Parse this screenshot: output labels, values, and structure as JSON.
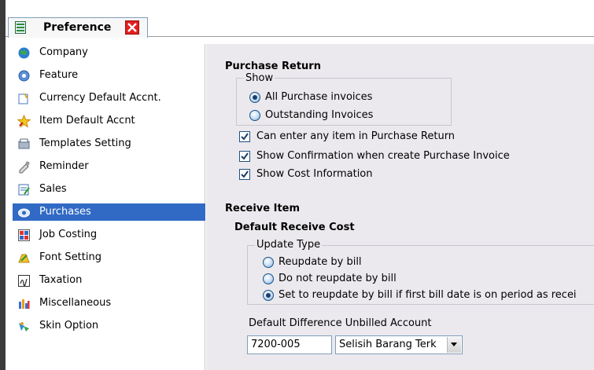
{
  "tab": {
    "label": "Preference"
  },
  "sidebar": {
    "items": [
      {
        "label": "Company",
        "icon": "globe-icon"
      },
      {
        "label": "Feature",
        "icon": "gear-icon"
      },
      {
        "label": "Currency Default Accnt.",
        "icon": "currency-icon"
      },
      {
        "label": "Item Default Accnt",
        "icon": "star-icon"
      },
      {
        "label": "Templates Setting",
        "icon": "templates-icon"
      },
      {
        "label": "Reminder",
        "icon": "reminder-icon"
      },
      {
        "label": "Sales",
        "icon": "sales-icon"
      },
      {
        "label": "Purchases",
        "icon": "purchases-icon",
        "selected": true
      },
      {
        "label": "Job Costing",
        "icon": "job-costing-icon"
      },
      {
        "label": "Font Setting",
        "icon": "font-icon"
      },
      {
        "label": "Taxation",
        "icon": "taxation-icon"
      },
      {
        "label": "Miscellaneous",
        "icon": "miscellaneous-icon"
      },
      {
        "label": "Skin Option",
        "icon": "skin-icon"
      }
    ]
  },
  "purchase_return": {
    "title": "Purchase Return",
    "show_legend": "Show",
    "options": [
      "All Purchase invoices",
      "Outstanding Invoices"
    ],
    "selected_option": "All Purchase invoices",
    "checkboxes": [
      {
        "label": "Can enter any item in Purchase Return",
        "checked": true
      },
      {
        "label": "Show Confirmation when create Purchase Invoice",
        "checked": true
      },
      {
        "label": "Show Cost Information",
        "checked": true
      }
    ]
  },
  "receive_item": {
    "title": "Receive Item",
    "subtitle": "Default Receive Cost",
    "update_legend": "Update Type",
    "options": [
      "Reupdate by bill",
      "Do not reupdate by bill",
      "Set to reupdate by bill if first bill date is on period as recei"
    ],
    "selected_option": "Set to reupdate by bill if first bill date is on period as recei",
    "account_label": "Default Difference Unbilled Account",
    "account_code": "7200-005",
    "account_name": "Selisih Barang Terk"
  },
  "colors": {
    "selection": "#316ac5",
    "panel": "#ebe9ed",
    "close": "#e21f1f"
  }
}
